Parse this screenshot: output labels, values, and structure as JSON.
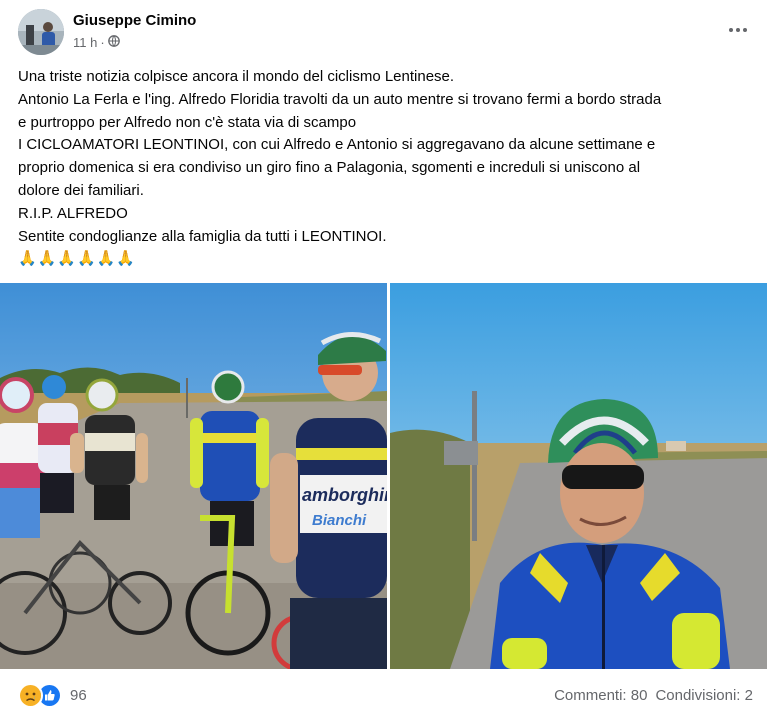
{
  "post": {
    "author": "Giuseppe Cimino",
    "time": "11 h",
    "separator": "·",
    "privacy_icon": "globe-icon",
    "text_lines": [
      "Una triste notizia colpisce ancora il mondo del ciclismo Lentinese.",
      "Antonio La Ferla e l'ing. Alfredo Floridia travolti da un auto mentre si trovano fermi a bordo strada",
      "e purtroppo per Alfredo non c'è stata via di scampo",
      "I CICLOAMATORI LEONTINOI, con cui Alfredo e Antonio si aggregavano da alcune settimane e",
      "proprio domenica si era condiviso un giro fino a Palagonia, sgomenti e increduli si uniscono al",
      "dolore dei familiari.",
      "R.I.P. ALFREDO",
      "Sentite condoglianze alla famiglia da tutti i LEONTINOI."
    ],
    "emoji_line": "🙏🙏🙏🙏🙏🙏",
    "photo_jersey_text": {
      "line1": "amborghini",
      "line2": "Bianchi"
    },
    "reactions": {
      "icons": [
        "sad-reaction-icon",
        "like-reaction-icon"
      ],
      "count": "96"
    },
    "comments": "Commenti: 80",
    "shares": "Condivisioni: 2"
  },
  "colors": {
    "secondary_text": "#65676b",
    "like_blue": "#1877f2",
    "sad_yellow": "#f7b125"
  }
}
